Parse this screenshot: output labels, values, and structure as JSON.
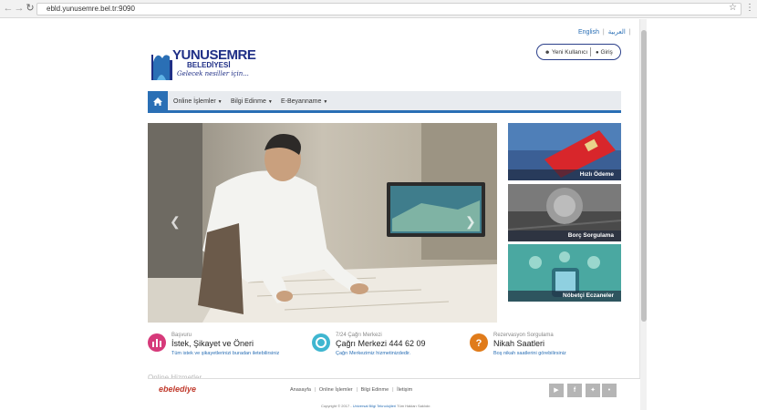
{
  "browser": {
    "url": "ebld.yunusemre.bel.tr:9090",
    "icons": [
      "back-arrow",
      "forward-arrow",
      "reload",
      "bookmark-star",
      "menu-dots"
    ]
  },
  "header": {
    "lang_english": "English",
    "lang_sep": "|",
    "lang_arabic": "العربية",
    "lang_end": "|",
    "new_user": "Yeni Kullanıcı",
    "login": "Giriş"
  },
  "logo": {
    "line1": "YUNUSEMRE",
    "line2": "BELEDİYESİ",
    "tagline": "Gelecek nesiller için..."
  },
  "menu": {
    "items": [
      {
        "label": "Online İşlemler"
      },
      {
        "label": "Bilgi Edinme"
      },
      {
        "label": "E-Beyanname"
      }
    ]
  },
  "tiles": [
    {
      "label": "Hızlı Ödeme"
    },
    {
      "label": "Borç Sorgulama"
    },
    {
      "label": "Nöbetçi Eczaneler"
    }
  ],
  "services": [
    {
      "sub": "Başvuru",
      "title": "İstek, Şikayet ve Öneri",
      "link": "Tüm istek ve şikayetlerinizi buradan iletebilirsiniz",
      "color": "#d63a7a"
    },
    {
      "sub": "7/24 Çağrı Merkezi",
      "title": "Çağrı Merkezi 444 62 09",
      "link": "Çağrı Merkezimiz hizmetinizdedir.",
      "color": "#3fb6d0"
    },
    {
      "sub": "Rezervasyon Sorgulama",
      "title": "Nikah Saatleri",
      "link": "Boş nikah saatlerini görebilirsiniz",
      "color": "#e07b1a"
    }
  ],
  "partial_heading": "Online Hizmetler",
  "footer": {
    "brand": "ebelediye",
    "links": [
      "Anasayfa",
      "Online İşlemler",
      "Bilgi Edinme",
      "İletişim"
    ],
    "social": [
      "youtube",
      "facebook",
      "twitter",
      "rss"
    ],
    "copyright_prefix": "Copyright © 2017 -",
    "copyright_company": "Universal Bilgi Teknolojileri",
    "copyright_suffix": "Tüm Hakları Saklıdır."
  }
}
